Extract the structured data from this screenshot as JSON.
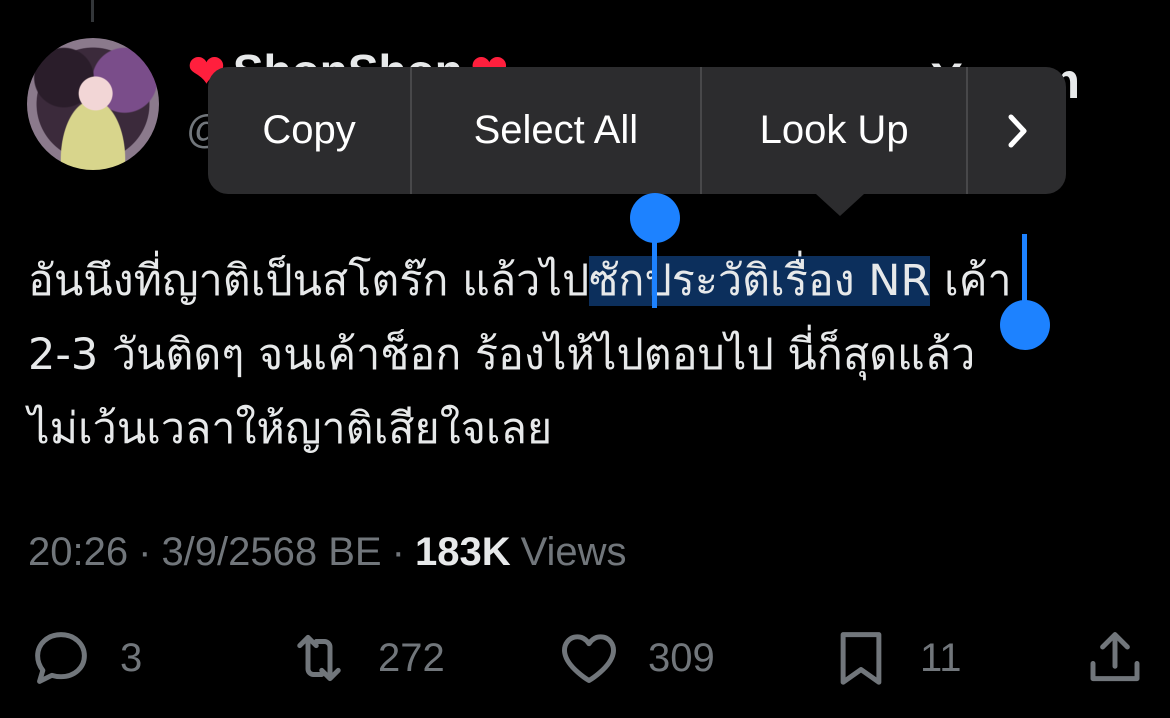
{
  "author": {
    "display_name_prefix": "❤",
    "display_name": "ShonShon",
    "display_name_suffix": "❤",
    "handle": "@",
    "site_mark": "X.com"
  },
  "context_menu": {
    "items": [
      "Copy",
      "Select All",
      "Look Up"
    ],
    "more": "›"
  },
  "tweet": {
    "line1_before": "อันนึงที่ญาติเป็นสโตร๊ก แล้วไป",
    "line1_selected": "ซักประวัติเรื่อง NR",
    "line1_after": " เค้า",
    "line2": "2-3 วันติดๆ จนเค้าช็อก ร้องไห้ไปตอบไป นี่ก็สุดแล้ว",
    "line3": "ไม่เว้นเวลาให้ญาติเสียใจเลย"
  },
  "meta": {
    "time": "20:26",
    "separator": "·",
    "date": "3/9/2568 BE",
    "views_count": "183K",
    "views_label": "Views"
  },
  "actions": {
    "replies": "3",
    "reposts": "272",
    "likes": "309",
    "bookmarks": "11"
  },
  "icons": [
    "reply-icon",
    "repost-icon",
    "like-icon",
    "bookmark-icon",
    "share-icon"
  ],
  "colors": {
    "background": "#000000",
    "text": "#e7e9ea",
    "muted": "#71767b",
    "selection_handle": "#1d82ff",
    "selection_fill": "#0c2f5c",
    "menu_bg": "#2c2c2e"
  }
}
